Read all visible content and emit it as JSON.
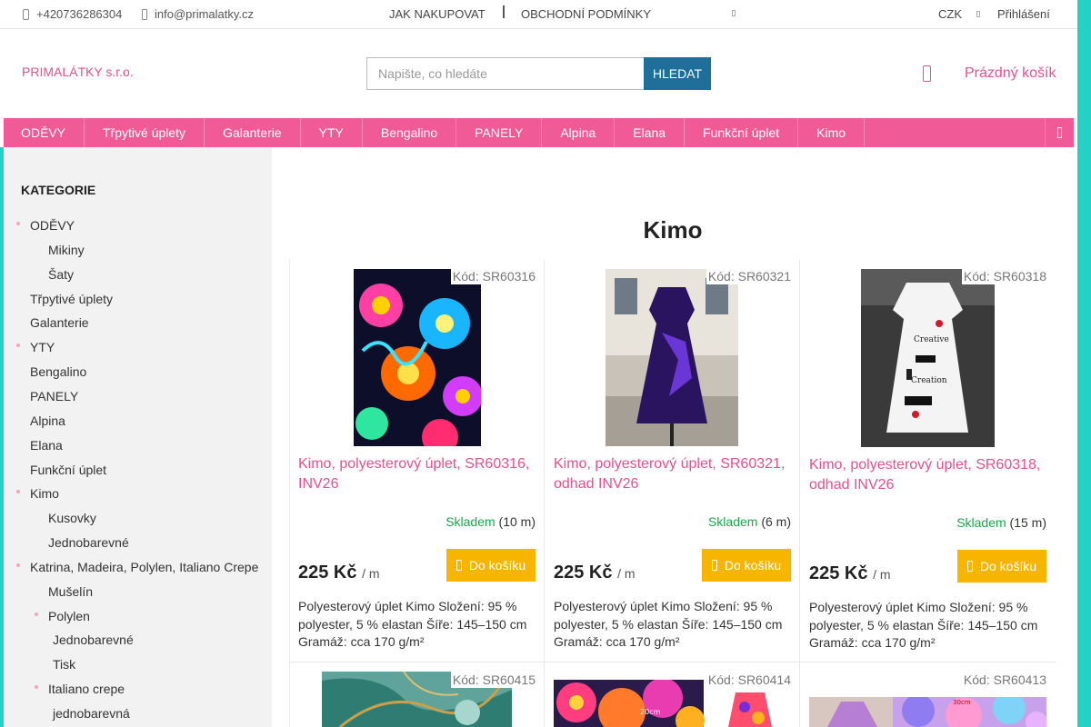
{
  "topbar": {
    "phone": "+420736286304",
    "email": "info@primalatky.cz",
    "links": [
      "JAK NAKUPOVAT",
      "OBCHODNÍ PODMÍNKY"
    ],
    "currency": "CZK",
    "login": "Přihlášení"
  },
  "header": {
    "logo": "PRIMALÁTKY s.r.o.",
    "search_placeholder": "Napište, co hledáte",
    "search_button": "HLEDAT",
    "cart_label": "Prázdný košík"
  },
  "menu": [
    "ODĚVY",
    "Třpytivé úplety",
    "Galanterie",
    "YTY",
    "Bengalino",
    "PANELY",
    "Alpina",
    "Elana",
    "Funkční úplet",
    "Kimo"
  ],
  "sidebar": {
    "heading": "KATEGORIE",
    "items": [
      {
        "label": "ODĚVY",
        "level": 0,
        "bullet": true
      },
      {
        "label": "Mikiny",
        "level": 1,
        "bullet": false
      },
      {
        "label": "Šaty",
        "level": 1,
        "bullet": false
      },
      {
        "label": "Třpytivé úplety",
        "level": 0,
        "bullet": false
      },
      {
        "label": "Galanterie",
        "level": 0,
        "bullet": false
      },
      {
        "label": "YTY",
        "level": 0,
        "bullet": true
      },
      {
        "label": "Bengalino",
        "level": 0,
        "bullet": false
      },
      {
        "label": "PANELY",
        "level": 0,
        "bullet": false
      },
      {
        "label": "Alpina",
        "level": 0,
        "bullet": false
      },
      {
        "label": "Elana",
        "level": 0,
        "bullet": false
      },
      {
        "label": "Funkční úplet",
        "level": 0,
        "bullet": false
      },
      {
        "label": "Kimo",
        "level": 0,
        "bullet": true
      },
      {
        "label": "Kusovky",
        "level": 1,
        "bullet": false
      },
      {
        "label": "Jednobarevné",
        "level": 1,
        "bullet": false
      },
      {
        "label": "Katrina, Madeira, Polylen, Italiano Crepe",
        "level": 0,
        "bullet": true
      },
      {
        "label": "Mušelín",
        "level": 1,
        "bullet": false
      },
      {
        "label": "Polylen",
        "level": 1,
        "bullet": true
      },
      {
        "label": "Jednobarevné",
        "level": 2,
        "bullet": false
      },
      {
        "label": "Tisk",
        "level": 2,
        "bullet": false
      },
      {
        "label": "Italiano crepe",
        "level": 1,
        "bullet": true
      },
      {
        "label": "jednobarevná",
        "level": 2,
        "bullet": false
      }
    ]
  },
  "page_title": "Kimo",
  "products": [
    {
      "code": "Kód: SR60316",
      "name": "Kimo, polyesterový úplet, SR60316, INV26",
      "stock_status": "Skladem",
      "stock_qty": "(10 m)",
      "price": "225 Kč",
      "unit": "/ m",
      "buy": "Do košíku",
      "desc": "Polyesterový úplet Kimo Složení: 95 % polyester, 5 % elastan Šíře: 145–150 cm Gramáž: cca 170 g/m²"
    },
    {
      "code": "Kód: SR60321",
      "name": "Kimo, polyesterový úplet, SR60321, odhad INV26",
      "stock_status": "Skladem",
      "stock_qty": "(6 m)",
      "price": "225 Kč",
      "unit": "/ m",
      "buy": "Do košíku",
      "desc": "Polyesterový úplet Kimo Složení: 95 % polyester, 5 % elastan Šíře: 145–150 cm Gramáž: cca 170 g/m²"
    },
    {
      "code": "Kód: SR60318",
      "name": "Kimo, polyesterový úplet, SR60318, odhad INV26",
      "stock_status": "Skladem",
      "stock_qty": "(15 m)",
      "price": "225 Kč",
      "unit": "/ m",
      "buy": "Do košíku",
      "desc": "Polyesterový úplet Kimo Složení: 95 % polyester, 5 % elastan Šíře: 145–150 cm Gramáž: cca 170 g/m²"
    },
    {
      "code": "Kód: SR60415"
    },
    {
      "code": "Kód: SR60414",
      "image_caption": "20cm"
    },
    {
      "code": "Kód: SR60413",
      "image_caption": "30cm"
    }
  ]
}
